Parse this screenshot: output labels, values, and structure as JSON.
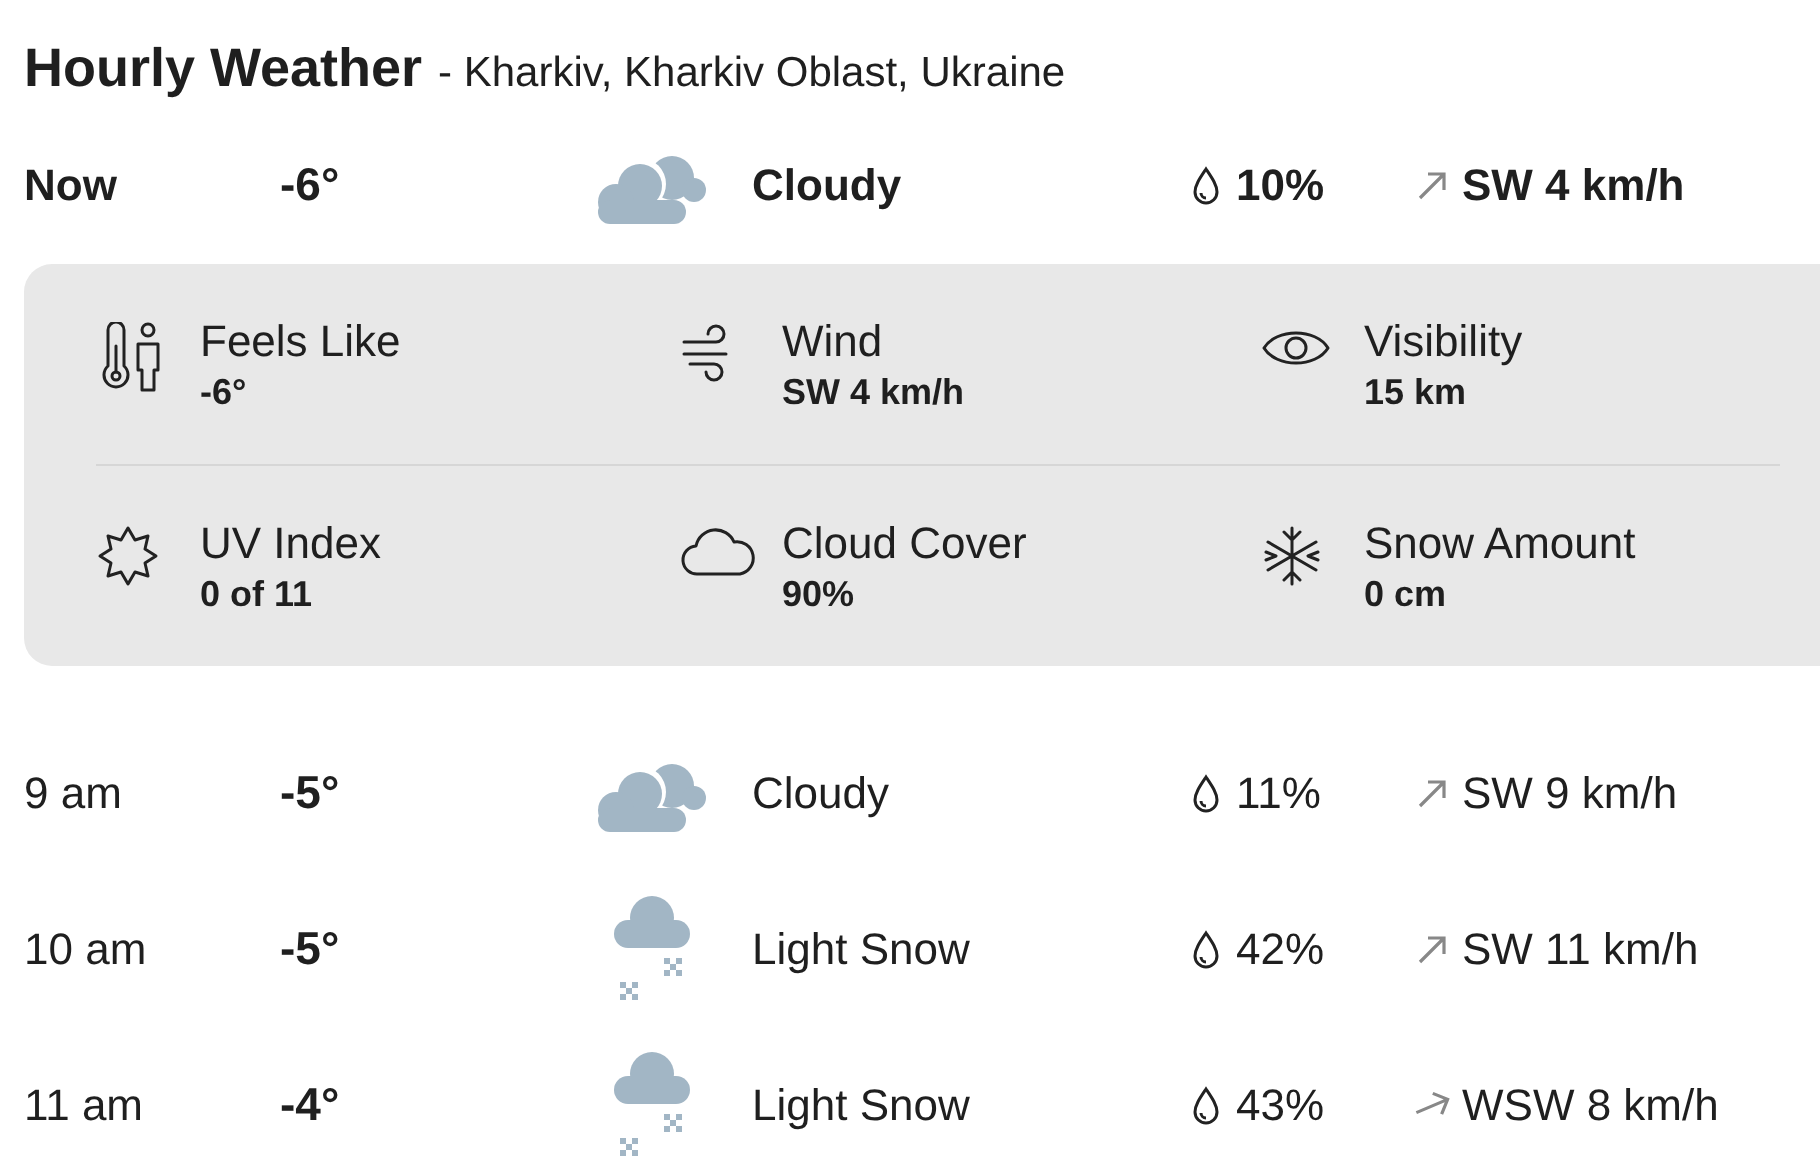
{
  "title": "Hourly Weather",
  "location": "- Kharkiv, Kharkiv Oblast, Ukraine",
  "current": {
    "time": "Now",
    "temp": "-6°",
    "kind": "cloudy",
    "condition": "Cloudy",
    "precip": "10%",
    "arrow": {
      "kind": "ne"
    },
    "wind": "SW 4 km/h"
  },
  "details": [
    {
      "kind": "feels",
      "label": "Feels Like",
      "value": "-6°"
    },
    {
      "kind": "wind",
      "label": "Wind",
      "value": "SW 4 km/h"
    },
    {
      "kind": "visibility",
      "label": "Visibility",
      "value": "15 km"
    },
    {
      "kind": "uv",
      "label": "UV Index",
      "value": "0 of 11"
    },
    {
      "kind": "cloud",
      "label": "Cloud Cover",
      "value": "90%"
    },
    {
      "kind": "snow",
      "label": "Snow Amount",
      "value": "0 cm"
    }
  ],
  "hours": [
    {
      "time": "9 am",
      "temp": "-5°",
      "kind": "cloudy",
      "condition": "Cloudy",
      "precip": "11%",
      "arrow": {
        "kind": "ne"
      },
      "wind": "SW 9 km/h"
    },
    {
      "time": "10 am",
      "temp": "-5°",
      "kind": "snow",
      "condition": "Light Snow",
      "precip": "42%",
      "arrow": {
        "kind": "ne"
      },
      "wind": "SW 11 km/h"
    },
    {
      "time": "11 am",
      "temp": "-4°",
      "kind": "snow",
      "condition": "Light Snow",
      "precip": "43%",
      "arrow": {
        "kind": "ene"
      },
      "wind": "WSW 8 km/h"
    }
  ]
}
